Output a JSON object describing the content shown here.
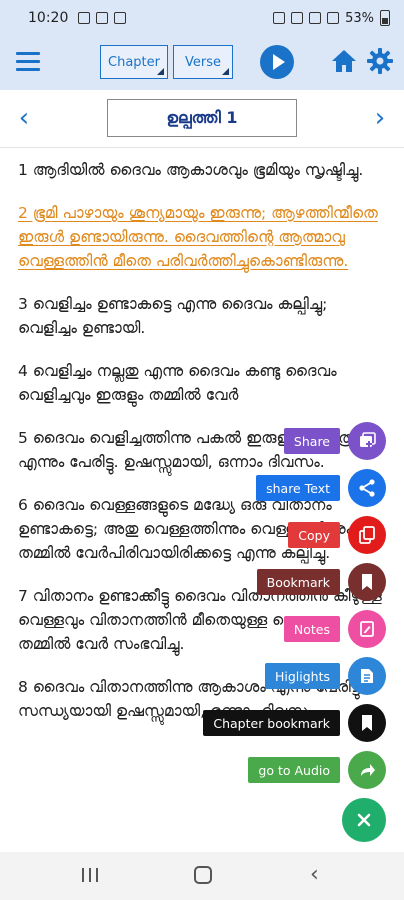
{
  "status_bar": {
    "time": "10:20",
    "left_icons": [
      "image-icon",
      "mail-icon",
      "lock-icon"
    ],
    "right_icons": [
      "alarm-icon",
      "mute-icon",
      "wifi-icon",
      "signal-icon"
    ],
    "battery": "53%"
  },
  "toolbar": {
    "chapter_label": "Chapter",
    "verse_label": "Verse"
  },
  "chapter_nav": {
    "title": "ഉല്പത്തി 1"
  },
  "verses": [
    {
      "text": "1 ആദിയിൽ ദൈവം ആകാശവും ഭൂമിയും സൃഷ്ടിച്ചു.",
      "highlighted": false
    },
    {
      "text": "2 ഭൂമി പാഴായും ശൂന്യമായും ഇരുന്നു; ആഴത്തിന്മീതെ ഇരുൾ ഉണ്ടായിരുന്നു. ദൈവത്തിന്റെ ആത്മാവു വെള്ളത്തിൻ മീതെ പരിവർത്തിച്ചുകൊണ്ടിരുന്നു.",
      "highlighted": true
    },
    {
      "text": "3 വെളിച്ചം ഉണ്ടാകട്ടെ എന്നു ദൈവം കല്പിച്ചു; വെളിച്ചം ഉണ്ടായി.",
      "highlighted": false
    },
    {
      "text": "4 വെളിച്ചം നല്ലതു എന്നു ദൈവം കണ്ടു ദൈവം വെളിച്ചവും ഇരുളും തമ്മിൽ വേർ",
      "highlighted": false
    },
    {
      "text": "5 ദൈവം വെളിച്ചത്തിന്നു പകൽ ഇരുളിന്നു രാത്രി എന്നും പേരിട്ടു. ഉഷസ്സുമായി, ഒന്നാം ദിവസം.",
      "highlighted": false
    },
    {
      "text": "6 ദൈവം വെള്ളങ്ങളുടെ മദ്ധ്യേ ഒരു വിതാനം ഉണ്ടാകട്ടെ; അതു വെള്ളത്തിന്നും വെള്ളത്തിന്നും തമ്മിൽ വേർപിരിവായിരിക്കട്ടെ എന്നു കല്പിച്ചു.",
      "highlighted": false
    },
    {
      "text": "7 വിതാനം ഉണ്ടാക്കീട്ടു ദൈവം വിതാനത്തിൻ കീഴുള്ള വെള്ളവും വിതാനത്തിൻ മീതെയുള്ള വെള്ളവും തമ്മിൽ വേർ സംഭവിച്ചു.",
      "highlighted": false
    },
    {
      "text": "8 ദൈവം വിതാനത്തിന്നു ആകാശം എന്നു പേരിട്ടു. സന്ധ്യയായി ഉഷസ്സുമായി, രണ്ടാം ദിവസം.",
      "highlighted": false
    }
  ],
  "actions": [
    {
      "label": "Share",
      "icon": "add-to-photo-icon",
      "label_color": "#7b52c9",
      "button_color": "#7b52c9"
    },
    {
      "label": "share Text",
      "icon": "share-icon",
      "label_color": "#1a73e8",
      "button_color": "#1a73e8"
    },
    {
      "label": "Copy",
      "icon": "copy-icon",
      "label_color": "#e23a3a",
      "button_color": "#e21b1b"
    },
    {
      "label": "Bookmark",
      "icon": "bookmark-icon",
      "label_color": "#7a2f2f",
      "button_color": "#7a2f2f"
    },
    {
      "label": "Notes",
      "icon": "edit-note-icon",
      "label_color": "#ee4fa2",
      "button_color": "#ee4fa2"
    },
    {
      "label": "Higlights",
      "icon": "highlight-icon",
      "label_color": "#2d86d8",
      "button_color": "#2d86d8"
    },
    {
      "label": "Chapter bookmark",
      "icon": "bookmark-icon",
      "label_color": "#111111",
      "button_color": "#111111"
    },
    {
      "label": "go to Audio",
      "icon": "forward-arrow-icon",
      "label_color": "#4aa94a",
      "button_color": "#4aa94a"
    }
  ],
  "close_button": {
    "icon": "close-icon",
    "color": "#1fae6b"
  },
  "colors": {
    "accent": "#1a73c8",
    "toolbar_bg": "#dbe6f7",
    "highlight_text": "#e08a1e"
  }
}
